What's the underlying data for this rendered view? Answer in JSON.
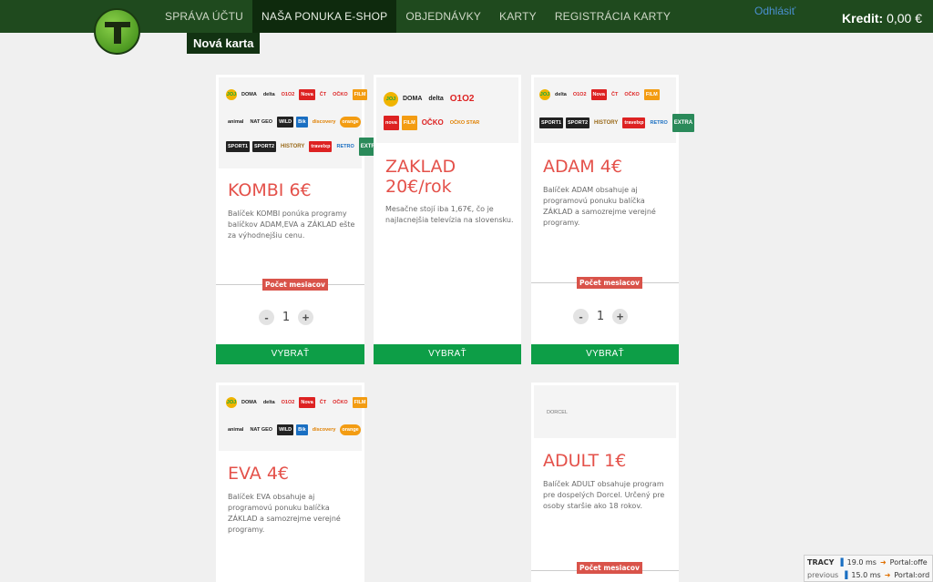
{
  "nav": {
    "items": [
      "SPRÁVA ÚČTU",
      "NAŠA PONUKA E-SHOP",
      "OBJEDNÁVKY",
      "KARTY",
      "REGISTRÁCIA KARTY"
    ],
    "active_index": 1,
    "subtab": "Nová karta",
    "logout": "Odhlásiť",
    "credit_label": "Kredit:",
    "credit_value": "0,00 €"
  },
  "cards": [
    {
      "title": "KOMBI 6€",
      "desc": "Balíček KOMBI ponúka programy balíčkov ADAM,EVA a ZÁKLAD ešte za výhodnejšiu cenu.",
      "months_label": "Počet mesiacov",
      "qty": "1",
      "button": "VYBRAŤ",
      "logo_rows": [
        [
          "JOJ",
          "DOMA",
          "delta",
          "O1O2",
          "Nova",
          "ČT",
          "OČKO",
          "FILM"
        ],
        [
          "animal",
          "NAT GEO",
          "WILD",
          "Bik",
          "discovery",
          "orange"
        ],
        [
          "SPORT1",
          "SPORT2",
          "HISTORY",
          "travelxp",
          "RETRO",
          "EXTRA"
        ]
      ]
    },
    {
      "title": "ZAKLAD 20€/rok",
      "desc": "Mesačne stojí iba 1,67€, čo je najlacnejšia televízia na slovensku.",
      "button": "VYBRAŤ",
      "logo_rows": [
        [
          "JOJ",
          "DOMA",
          "delta",
          "O1O2"
        ],
        [
          "nova",
          "FILM",
          "OČKO",
          "OČKO STAR"
        ]
      ]
    },
    {
      "title": "ADAM 4€",
      "desc": "Balíček ADAM obsahuje aj programovú ponuku balíčka ZÁKLAD a samozrejme verejné programy.",
      "months_label": "Počet mesiacov",
      "qty": "1",
      "button": "VYBRAŤ",
      "logo_rows": [
        [
          "JOJ",
          "delta",
          "O1O2",
          "Nova",
          "ČT",
          "OČKO",
          "FILM"
        ],
        [
          "SPORT1",
          "SPORT2",
          "HISTORY",
          "travelxp",
          "RETRO",
          "EXTRA"
        ]
      ]
    },
    {
      "title": "EVA 4€",
      "desc": "Balíček EVA obsahuje aj programovú ponuku balíčka ZÁKLAD a samozrejme verejné programy.",
      "logo_rows": [
        [
          "JOJ",
          "DOMA",
          "delta",
          "O1O2",
          "Nova",
          "ČT",
          "OČKO",
          "FILM"
        ],
        [
          "animal",
          "NAT GEO",
          "WILD",
          "Bik",
          "discovery",
          "orange"
        ]
      ]
    },
    {
      "title": "ADULT 1€",
      "desc": "Balíček ADULT obsahuje program pre dospelých Dorcel. Určený pre osoby staršie ako 18 rokov.",
      "months_label": "Počet mesiacov",
      "logo_rows": [
        [
          "DORCEL"
        ]
      ]
    }
  ],
  "tracy": {
    "label": "TRACY",
    "prev_label": "previous",
    "time1": "19.0 ms",
    "time2": "15.0 ms",
    "link1": "Portal:offe",
    "link2": "Portal:ord"
  }
}
